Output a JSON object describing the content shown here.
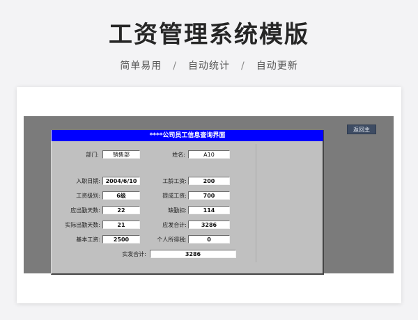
{
  "header": {
    "title": "工资管理系统模版",
    "features": [
      "简单易用",
      "自动统计",
      "自动更新"
    ],
    "separator": "/"
  },
  "toolbar": {
    "return_label": "返回主"
  },
  "panel": {
    "title": "****公司员工信息查询界面",
    "department_label": "部门:",
    "department_value": "销售部",
    "name_label": "姓名:",
    "name_value": "A10",
    "rows": [
      {
        "left_label": "入职日期:",
        "left_value": "2004/6/10",
        "right_label": "工龄工资:",
        "right_value": "200"
      },
      {
        "left_label": "工资级别:",
        "left_value": "6级",
        "right_label": "提成工资:",
        "right_value": "700"
      },
      {
        "left_label": "应出勤天数:",
        "left_value": "22",
        "right_label": "缺勤扣:",
        "right_value": "114"
      },
      {
        "left_label": "实际出勤天数:",
        "left_value": "21",
        "right_label": "应发合计:",
        "right_value": "3286"
      },
      {
        "left_label": "基本工资:",
        "left_value": "2500",
        "right_label": "个人所得税:",
        "right_value": "0"
      }
    ],
    "net_label": "实发合计:",
    "net_value": "3286"
  }
}
